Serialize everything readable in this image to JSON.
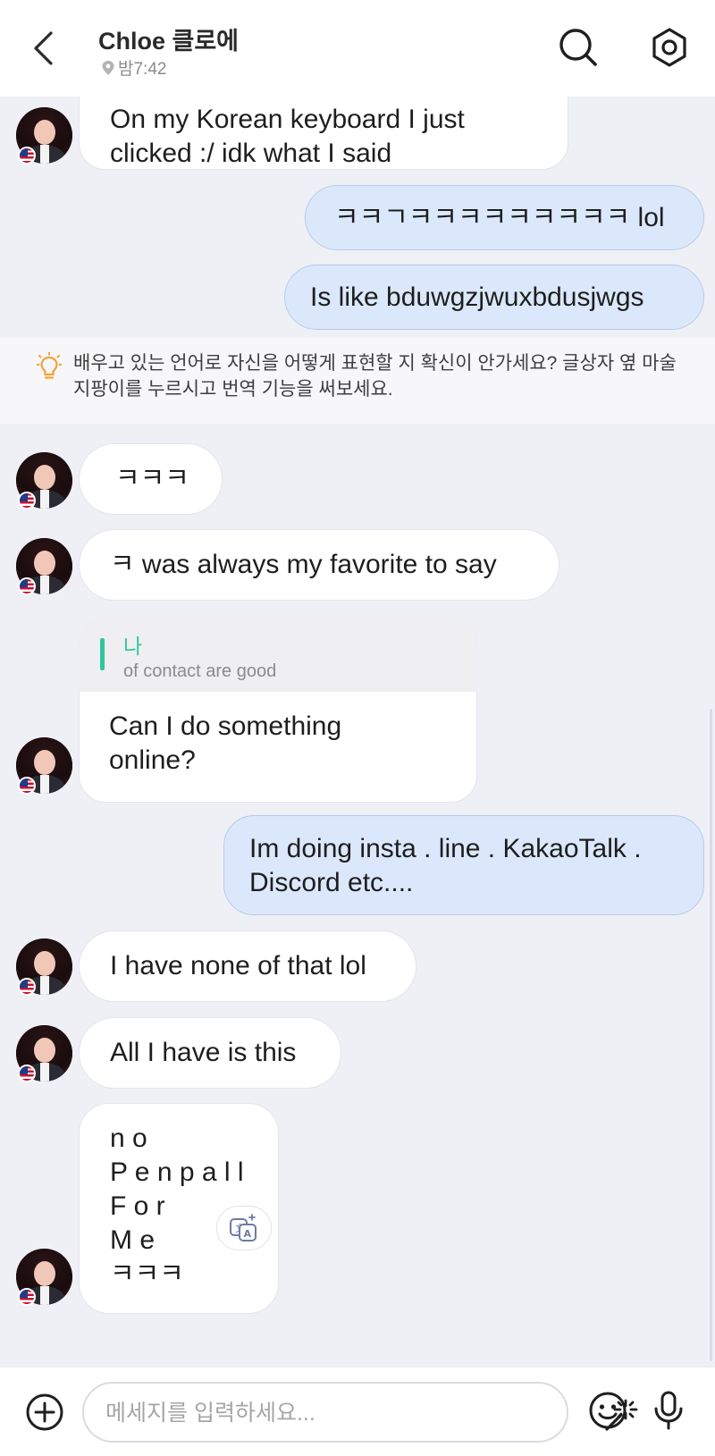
{
  "header": {
    "back_icon": "chevron-left-icon",
    "title": "Chloe 클로에",
    "location_icon": "location-pin-icon",
    "local_time": "밤7:42",
    "search_icon": "search-icon",
    "settings_icon": "settings-icon"
  },
  "messages": {
    "m1": "On my Korean keyboard I just\nclicked :/ idk what I said",
    "m2": "ㅋㅋㄱㅋㅋㅋㅋㅋㅋㅋㅋㅋ lol",
    "m3": "Is like bduwgzjwuxbdusjwgs",
    "m4": "ㅋㅋㅋ",
    "m5": "ㅋ was always my favorite to say",
    "m6": "Can I do something\nonline?",
    "m7": "Im doing insta . line . KakaoTalk .\nDiscord etc....",
    "m8": "I have none of that lol",
    "m9": "All I have is this",
    "m10": "n o\nP e n p a l l\nF o r\nM e\nㅋㅋㅋ"
  },
  "reply_quote": {
    "name": "나",
    "text": "of contact are good"
  },
  "tip": {
    "icon": "lightbulb-icon",
    "text": "배우고 있는 언어로 자신을 어떻게 표현할 지 확신이 안가세요? 글상자 옆 마술 지팡이를 누르시고 번역 기능을 써보세요."
  },
  "translate_button_icon": "translate-icon",
  "composer": {
    "plus_icon": "plus-circle-icon",
    "placeholder": "메세지를 입력하세요...",
    "magic_icon": "magic-wand-icon",
    "emoji_icon": "emoji-icon",
    "mic_icon": "microphone-icon"
  },
  "colors": {
    "sent_bubble": "#dbe8fb",
    "received_bubble": "#ffffff",
    "chat_background": "#eef0f6",
    "accent": "#2fc5a2",
    "tip_icon": "#f2a23a"
  }
}
